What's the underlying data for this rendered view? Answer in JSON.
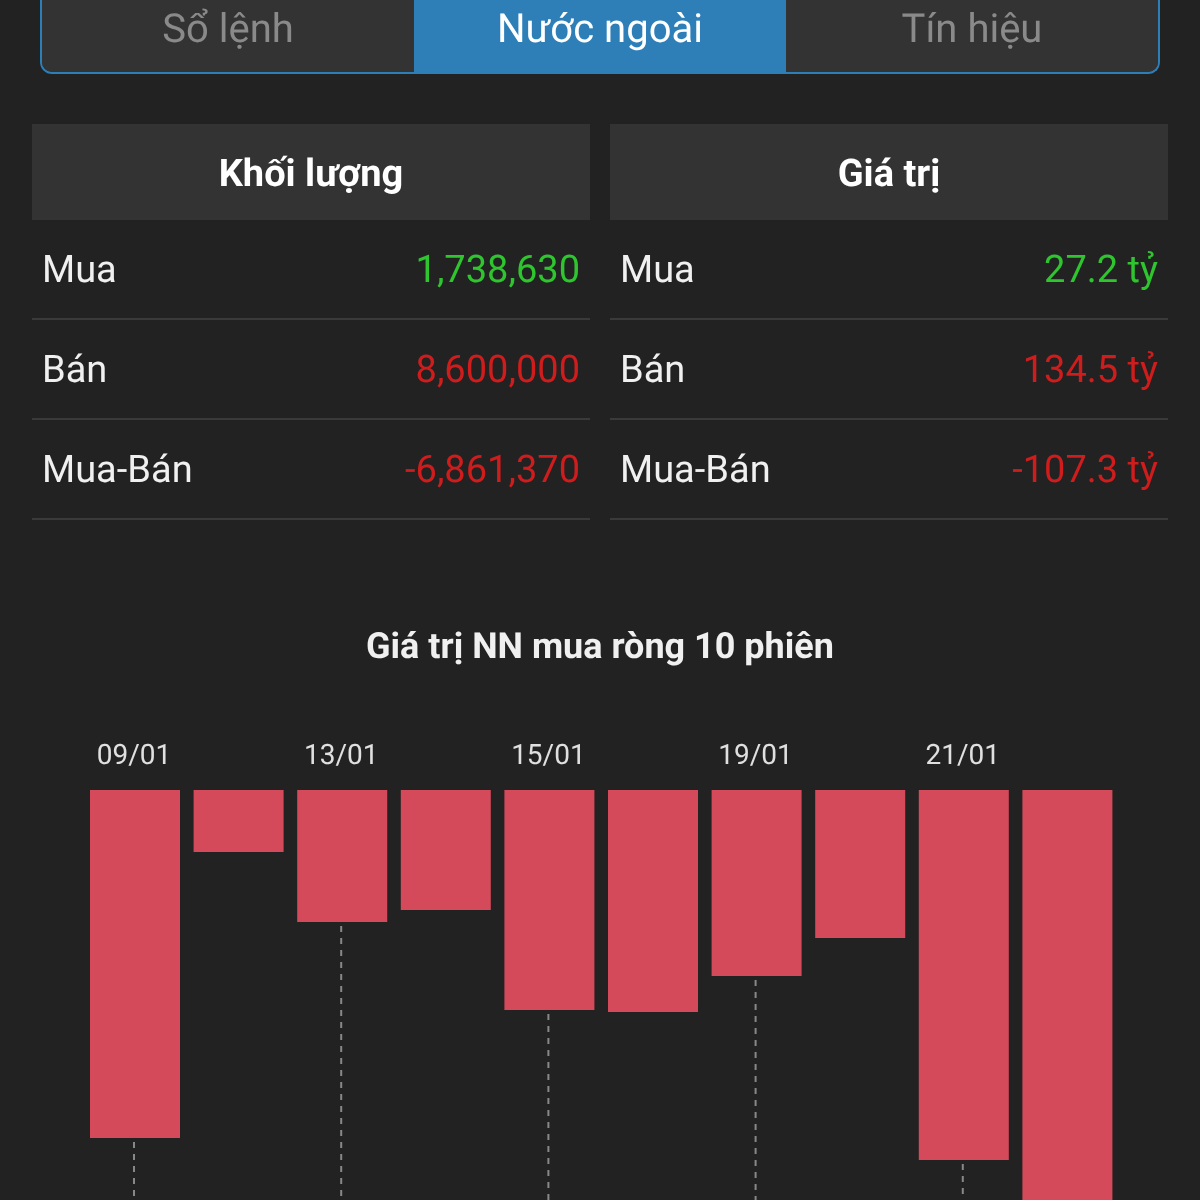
{
  "tabs": [
    {
      "label": "Sổ lệnh",
      "selected": false
    },
    {
      "label": "Nước ngoài",
      "selected": true
    },
    {
      "label": "Tín hiệu",
      "selected": false
    }
  ],
  "tables": [
    {
      "header": "Khối lượng",
      "rows": [
        {
          "label": "Mua",
          "value": "1,738,630",
          "color": "#2fc52f"
        },
        {
          "label": "Bán",
          "value": "8,600,000",
          "color": "#cf1c1c"
        },
        {
          "label": "Mua-Bán",
          "value": "-6,861,370",
          "color": "#cf1c1c"
        }
      ]
    },
    {
      "header": "Giá trị",
      "rows": [
        {
          "label": "Mua",
          "value": "27.2 tỷ",
          "color": "#2fc52f"
        },
        {
          "label": "Bán",
          "value": "134.5 tỷ",
          "color": "#cf1c1c"
        },
        {
          "label": "Mua-Bán",
          "value": "-107.3 tỷ",
          "color": "#cf1c1c"
        }
      ]
    }
  ],
  "chart": {
    "title": "Giá trị NN mua ròng 10 phiên",
    "date_labels": [
      "09/01",
      "13/01",
      "15/01",
      "19/01",
      "21/01"
    ]
  }
}
